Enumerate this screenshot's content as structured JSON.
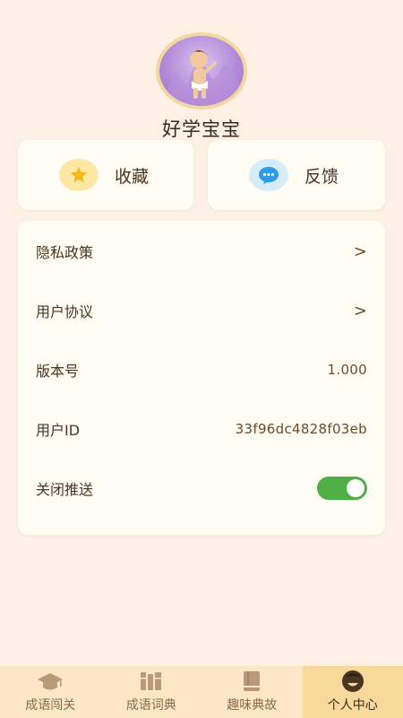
{
  "profile": {
    "nickname": "好学宝宝"
  },
  "quick_actions": [
    {
      "label": "收藏",
      "icon": "star-icon"
    },
    {
      "label": "反馈",
      "icon": "chat-bubble-icon"
    }
  ],
  "settings": {
    "privacy_policy": "隐私政策",
    "user_agreement": "用户协议",
    "version_label": "版本号",
    "version_value": "1.000",
    "user_id_label": "用户ID",
    "user_id_value": "33f96dc4828f03eb",
    "push_label": "关闭推送",
    "push_enabled": true,
    "chevron": ">"
  },
  "tabs": [
    {
      "label": "成语闯关",
      "icon": "graduation-cap-icon"
    },
    {
      "label": "成语词典",
      "icon": "books-icon"
    },
    {
      "label": "趣味典故",
      "icon": "book-icon"
    },
    {
      "label": "个人中心",
      "icon": "smiley-face-icon",
      "active": true
    }
  ],
  "colors": {
    "background": "#fcf1e4",
    "card": "#fffcf3",
    "toggle_on": "#4fae45",
    "tab_active": "#f8d99c",
    "tabbar": "#fbe7c5"
  }
}
